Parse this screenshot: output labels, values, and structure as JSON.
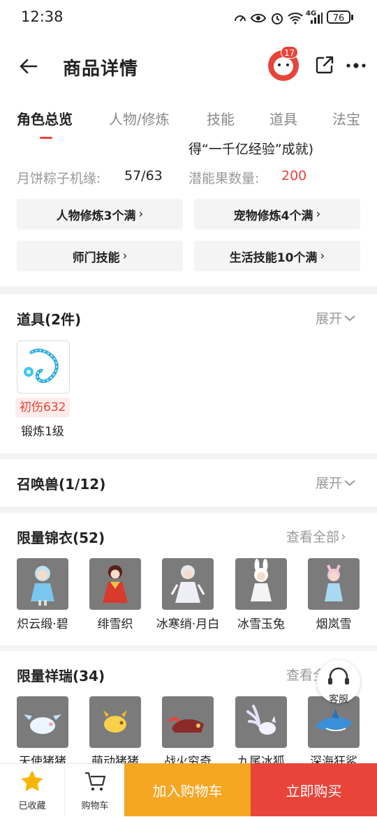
{
  "status_bar": {
    "time": "12:38",
    "network": "4G",
    "battery": "76"
  },
  "header": {
    "title": "商品详情",
    "badge_count": "17"
  },
  "tabs": [
    {
      "label": "角色总览",
      "active": true
    },
    {
      "label": "人物/修炼",
      "active": false
    },
    {
      "label": "技能",
      "active": false
    },
    {
      "label": "道具",
      "active": false
    },
    {
      "label": "法宝",
      "active": false
    }
  ],
  "character": {
    "partial_text": "得“一千亿经验”成就)",
    "mooncake_label": "月饼粽子机缘:",
    "mooncake_value": "57/63",
    "potential_label": "潜能果数量:",
    "potential_value": "200",
    "buttons": [
      "人物修炼3个满",
      "宠物修炼4个满",
      "师门技能",
      "生活技能10个满"
    ]
  },
  "items_section": {
    "title": "道具(2件)",
    "action": "展开",
    "item": {
      "badge": "初伤632",
      "label": "锻炼1级"
    }
  },
  "summon_section": {
    "title": "召唤兽(1/12)",
    "action": "展开"
  },
  "costume_section": {
    "title": "限量锦衣(52)",
    "action": "查看全部",
    "items": [
      "炽云缎·碧",
      "绯雪织",
      "冰寒绡·月白",
      "冰雪玉兔",
      "烟岚雪"
    ]
  },
  "auspicious_section": {
    "title": "限量祥瑞(34)",
    "action": "查看全部",
    "items": [
      "天使猪猪",
      "萌动猪猪",
      "战火穷奇",
      "九尾冰狐",
      "深海狂鲨"
    ]
  },
  "floating": {
    "service_label": "客服"
  },
  "bottom_bar": {
    "favorite_label": "已收藏",
    "cart_label": "购物车",
    "add_to_cart": "加入购物车",
    "buy_now": "立即购买"
  },
  "colors": {
    "accent_red": "#e8443a",
    "cart_orange": "#f5a623",
    "star_yellow": "#f7b500"
  }
}
